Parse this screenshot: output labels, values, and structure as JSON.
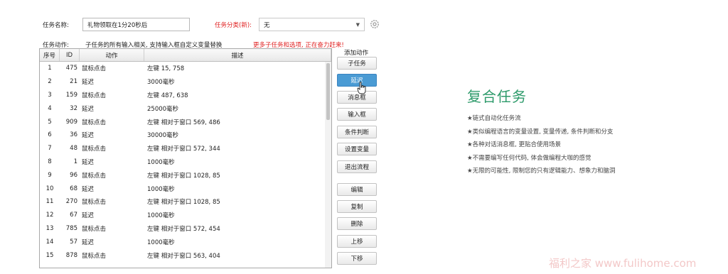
{
  "form": {
    "task_name_label": "任务名称:",
    "task_name_value": "礼物领取在1分20秒后",
    "task_category_label": "任务分类(新):",
    "task_category_value": "无",
    "task_action_label": "任务动作:",
    "task_hint": "子任务的所有输入相关, 支持输入框自定义变量替换",
    "task_hint_red": "更多子任务和选项, 正在奋力赶来!"
  },
  "table": {
    "headers": {
      "no": "序号",
      "id": "ID",
      "action": "动作",
      "desc": "描述"
    },
    "rows": [
      {
        "no": "1",
        "id": "475",
        "action": "鼠标点击",
        "desc": "左键 15, 758"
      },
      {
        "no": "2",
        "id": "21",
        "action": "延迟",
        "desc": "3000毫秒"
      },
      {
        "no": "3",
        "id": "159",
        "action": "鼠标点击",
        "desc": "左键 487, 638"
      },
      {
        "no": "4",
        "id": "32",
        "action": "延迟",
        "desc": "25000毫秒"
      },
      {
        "no": "5",
        "id": "909",
        "action": "鼠标点击",
        "desc": "左键 相对于窗口 569, 486"
      },
      {
        "no": "6",
        "id": "36",
        "action": "延迟",
        "desc": "30000毫秒"
      },
      {
        "no": "7",
        "id": "48",
        "action": "鼠标点击",
        "desc": "左键 相对于窗口 572, 344"
      },
      {
        "no": "8",
        "id": "1",
        "action": "延迟",
        "desc": "1000毫秒"
      },
      {
        "no": "9",
        "id": "96",
        "action": "鼠标点击",
        "desc": "左键 相对于窗口 1028, 85"
      },
      {
        "no": "10",
        "id": "68",
        "action": "延迟",
        "desc": "1000毫秒"
      },
      {
        "no": "11",
        "id": "270",
        "action": "鼠标点击",
        "desc": "左键 相对于窗口 1028, 85"
      },
      {
        "no": "12",
        "id": "67",
        "action": "延迟",
        "desc": "1000毫秒"
      },
      {
        "no": "13",
        "id": "785",
        "action": "鼠标点击",
        "desc": "左键 相对于窗口 572, 454"
      },
      {
        "no": "14",
        "id": "57",
        "action": "延迟",
        "desc": "1000毫秒"
      },
      {
        "no": "15",
        "id": "878",
        "action": "鼠标点击",
        "desc": "左键 相对于窗口 563, 404"
      }
    ]
  },
  "buttons": {
    "add_action_label": "添加动作",
    "subtask": "子任务",
    "delay": "延迟",
    "message_box": "消息框",
    "input_box": "输入框",
    "condition": "条件判断",
    "set_variable": "设置变量",
    "exit_flow": "退出流程",
    "edit": "编辑",
    "copy": "复制",
    "delete": "删除",
    "move_up": "上移",
    "move_down": "下移"
  },
  "panel": {
    "heading": "复合任务",
    "features": [
      "★链式自动化任务流",
      "★类似编程语言的变量设置, 变量传递, 条件判断和分支",
      "★各种对话消息框, 更贴合使用场景",
      "★不需要编写任何代码, 体会做编程大咖的感觉",
      "★无限的可能性, 限制您的只有逻辑能力、想象力和脑洞"
    ],
    "watermark": "福利之家 www.fulihome.com"
  },
  "colors": {
    "accent_green": "#2d9a6a",
    "active_button": "#4a9bd4",
    "warning_red": "#e02020"
  }
}
